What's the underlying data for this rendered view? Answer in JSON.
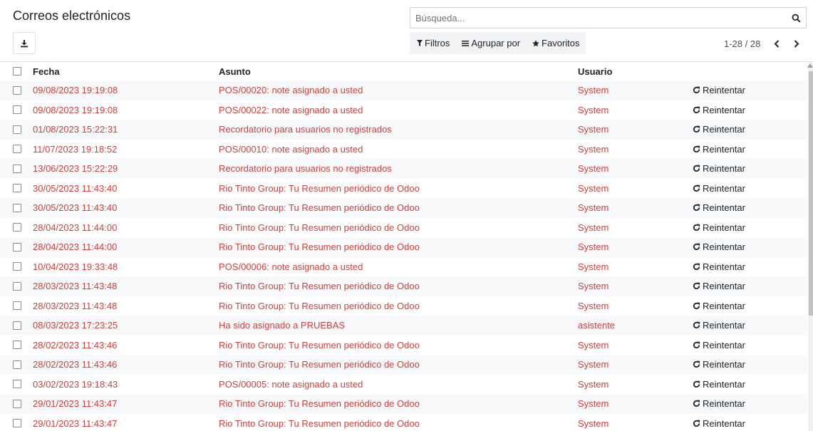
{
  "header": {
    "title": "Correos electrónicos",
    "search_placeholder": "Búsqueda...",
    "filters_label": "Filtros",
    "group_by_label": "Agrupar por",
    "favorites_label": "Favoritos",
    "pager_value": "1-28 / 28"
  },
  "columns": {
    "date": "Fecha",
    "subject": "Asunto",
    "user": "Usuario"
  },
  "retry_label": "Reintentar",
  "rows": [
    {
      "date": "09/08/2023 19:19:08",
      "subject": "POS/00020: note asignado a usted",
      "user": "System"
    },
    {
      "date": "09/08/2023 19:19:08",
      "subject": "POS/00022: note asignado a usted",
      "user": "System"
    },
    {
      "date": "01/08/2023 15:22:31",
      "subject": "Recordatorio para usuarios no registrados",
      "user": "System"
    },
    {
      "date": "11/07/2023 19:18:52",
      "subject": "POS/00010: note asignado a usted",
      "user": "System"
    },
    {
      "date": "13/06/2023 15:22:29",
      "subject": "Recordatorio para usuarios no registrados",
      "user": "System"
    },
    {
      "date": "30/05/2023 11:43:40",
      "subject": "Rio Tinto Group: Tu Resumen periódico de Odoo",
      "user": "System"
    },
    {
      "date": "30/05/2023 11:43:40",
      "subject": "Rio Tinto Group: Tu Resumen periódico de Odoo",
      "user": "System"
    },
    {
      "date": "28/04/2023 11:44:00",
      "subject": "Rio Tinto Group: Tu Resumen periódico de Odoo",
      "user": "System"
    },
    {
      "date": "28/04/2023 11:44:00",
      "subject": "Rio Tinto Group: Tu Resumen periódico de Odoo",
      "user": "System"
    },
    {
      "date": "10/04/2023 19:33:48",
      "subject": "POS/00006: note asignado a usted",
      "user": "System"
    },
    {
      "date": "28/03/2023 11:43:48",
      "subject": "Rio Tinto Group: Tu Resumen periódico de Odoo",
      "user": "System"
    },
    {
      "date": "28/03/2023 11:43:48",
      "subject": "Rio Tinto Group: Tu Resumen periódico de Odoo",
      "user": "System"
    },
    {
      "date": "08/03/2023 17:23:25",
      "subject": "Ha sido asignado a PRUEBAS",
      "user": "asistente"
    },
    {
      "date": "28/02/2023 11:43:46",
      "subject": "Rio Tinto Group: Tu Resumen periódico de Odoo",
      "user": "System"
    },
    {
      "date": "28/02/2023 11:43:46",
      "subject": "Rio Tinto Group: Tu Resumen periódico de Odoo",
      "user": "System"
    },
    {
      "date": "03/02/2023 19:18:43",
      "subject": "POS/00005: note asignado a usted",
      "user": "System"
    },
    {
      "date": "29/01/2023 11:43:47",
      "subject": "Rio Tinto Group: Tu Resumen periódico de Odoo",
      "user": "System"
    },
    {
      "date": "29/01/2023 11:43:47",
      "subject": "Rio Tinto Group: Tu Resumen periódico de Odoo",
      "user": "System"
    }
  ],
  "colors": {
    "failed_text": "#d23f3a",
    "row_stripe": "#f8f9fa",
    "options_bg": "#f2f3f4"
  },
  "icons": {
    "download": "download-icon",
    "search": "search-icon",
    "filter": "filter-icon",
    "group_by": "bars-icon",
    "favorites": "star-icon",
    "previous": "chevron-left-icon",
    "next": "chevron-right-icon",
    "retry": "refresh-icon"
  }
}
